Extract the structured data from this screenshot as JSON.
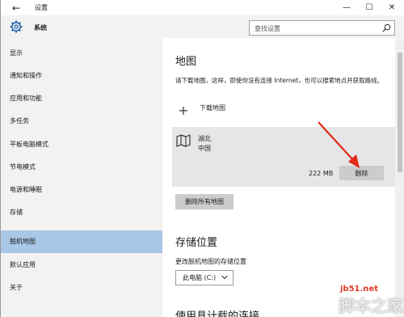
{
  "window": {
    "title": "设置",
    "back_glyph": "←",
    "min_glyph": "—",
    "max_glyph": "☐",
    "close_glyph": "✕"
  },
  "app": {
    "name": "系统",
    "icon": "gear-icon"
  },
  "search": {
    "placeholder": "查找设置",
    "icon": "search-icon"
  },
  "sidebar": {
    "items": [
      {
        "label": "显示",
        "active": false
      },
      {
        "label": "通知和操作",
        "active": false
      },
      {
        "label": "应用和功能",
        "active": false
      },
      {
        "label": "多任务",
        "active": false
      },
      {
        "label": "平板电脑模式",
        "active": false
      },
      {
        "label": "节电模式",
        "active": false
      },
      {
        "label": "电源和睡眠",
        "active": false
      },
      {
        "label": "存储",
        "active": false
      },
      {
        "label": "脱机地图",
        "active": true
      },
      {
        "label": "默认应用",
        "active": false
      },
      {
        "label": "关于",
        "active": false
      }
    ]
  },
  "main": {
    "maps_title": "地图",
    "maps_desc": "请下载地图，这样，即使你没有连接 Internet，也可以搜索地点并获取路线。",
    "download_glyph": "+",
    "download_label": "下载地图",
    "map_entry": {
      "region": "湖北",
      "country": "中国",
      "size": "222 MB",
      "delete_label": "删除",
      "icon": "map-icon"
    },
    "delete_all_label": "删除所有地图",
    "storage_title": "存储位置",
    "storage_desc": "更改脱机地图的存储位置",
    "storage_value": "此电脑 (C:)",
    "next_title_partial": "使用具计载的连接"
  },
  "colors": {
    "active_nav": "#a9c7e6",
    "annotation_arrow": "#e02a1a"
  },
  "watermark": {
    "logo": "jb51.net",
    "site": "脚本之家"
  }
}
